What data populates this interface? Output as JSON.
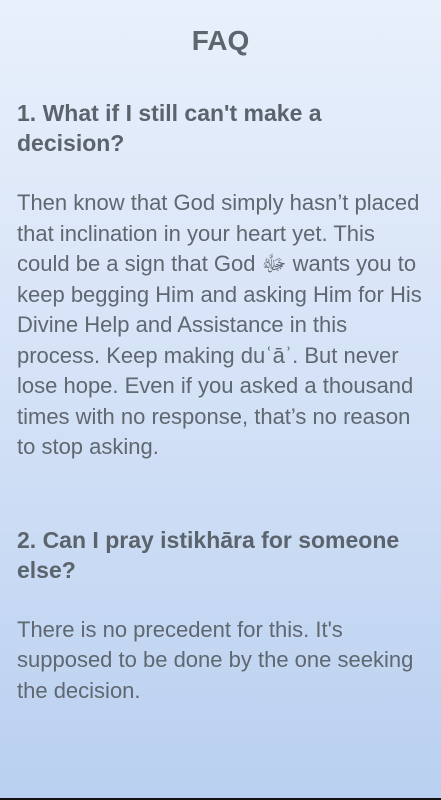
{
  "header": {
    "title": "FAQ"
  },
  "faq": [
    {
      "question": "1. What if I still can't make a decision?",
      "answer": "Then know that God simply hasn’t placed that inclination in your heart yet. This could be a sign that God ﷻ wants you to keep begging Him and asking Him for His Divine Help and Assistance in this process. Keep making duʿāʾ. But never lose hope. Even if you asked a thousand times with no response, that’s no reason to stop asking."
    },
    {
      "question": "2. Can I pray istikhāra for someone else?",
      "answer": "There is no precedent for this. It's supposed to be done by the one seeking the decision."
    }
  ]
}
